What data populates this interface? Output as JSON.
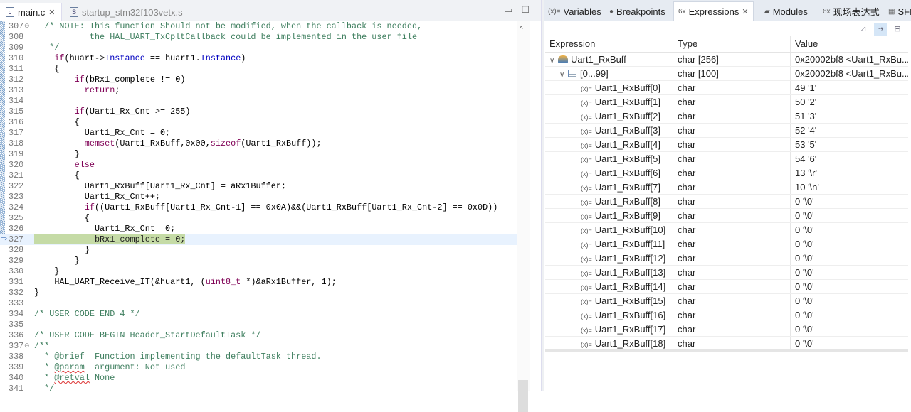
{
  "editor": {
    "tabs": [
      {
        "label": "main.c",
        "icon": "c-file-icon",
        "active": true
      },
      {
        "label": "startup_stm32f103vetx.s",
        "icon": "asm-file-icon",
        "active": false
      }
    ],
    "current_line": 327,
    "lines": [
      {
        "n": "307",
        "fold": true,
        "t": [
          [
            "cm",
            "  /* NOTE: This function Should not be modified, when the callback is needed,"
          ]
        ]
      },
      {
        "n": "308",
        "t": [
          [
            "cm",
            "           the HAL_UART_TxCpltCallback could be implemented in the user file"
          ]
        ]
      },
      {
        "n": "309",
        "t": [
          [
            "cm",
            "   */"
          ]
        ]
      },
      {
        "n": "310",
        "t": [
          [
            "pl",
            "    "
          ],
          [
            "kw",
            "if"
          ],
          [
            "pl",
            "(huart->"
          ],
          [
            "fld",
            "Instance"
          ],
          [
            "pl",
            " == huart1."
          ],
          [
            "fld",
            "Instance"
          ],
          [
            "pl",
            ")"
          ]
        ]
      },
      {
        "n": "311",
        "t": [
          [
            "pl",
            "    {"
          ]
        ]
      },
      {
        "n": "312",
        "t": [
          [
            "pl",
            "        "
          ],
          [
            "kw",
            "if"
          ],
          [
            "pl",
            "(bRx1_complete != 0)"
          ]
        ]
      },
      {
        "n": "313",
        "t": [
          [
            "pl",
            "          "
          ],
          [
            "kw",
            "return"
          ],
          [
            "pl",
            ";"
          ]
        ]
      },
      {
        "n": "314",
        "t": []
      },
      {
        "n": "315",
        "t": [
          [
            "pl",
            "        "
          ],
          [
            "kw",
            "if"
          ],
          [
            "pl",
            "(Uart1_Rx_Cnt >= 255)"
          ]
        ]
      },
      {
        "n": "316",
        "t": [
          [
            "pl",
            "        {"
          ]
        ]
      },
      {
        "n": "317",
        "t": [
          [
            "pl",
            "          Uart1_Rx_Cnt = 0;"
          ]
        ]
      },
      {
        "n": "318",
        "t": [
          [
            "pl",
            "          "
          ],
          [
            "kw",
            "memset"
          ],
          [
            "pl",
            "(Uart1_RxBuff,0x00,"
          ],
          [
            "kw",
            "sizeof"
          ],
          [
            "pl",
            "(Uart1_RxBuff));"
          ]
        ]
      },
      {
        "n": "319",
        "t": [
          [
            "pl",
            "        }"
          ]
        ]
      },
      {
        "n": "320",
        "t": [
          [
            "pl",
            "        "
          ],
          [
            "kw",
            "else"
          ]
        ]
      },
      {
        "n": "321",
        "t": [
          [
            "pl",
            "        {"
          ]
        ]
      },
      {
        "n": "322",
        "t": [
          [
            "pl",
            "          Uart1_RxBuff[Uart1_Rx_Cnt] = aRx1Buffer;"
          ]
        ]
      },
      {
        "n": "323",
        "t": [
          [
            "pl",
            "          Uart1_Rx_Cnt++;"
          ]
        ]
      },
      {
        "n": "324",
        "t": [
          [
            "pl",
            "          "
          ],
          [
            "kw",
            "if"
          ],
          [
            "pl",
            "((Uart1_RxBuff[Uart1_Rx_Cnt-1] == 0x0A)&&(Uart1_RxBuff[Uart1_Rx_Cnt-2] == 0x0D))"
          ]
        ]
      },
      {
        "n": "325",
        "t": [
          [
            "pl",
            "          {"
          ]
        ]
      },
      {
        "n": "326",
        "t": [
          [
            "pl",
            "            Uart1_Rx_Cnt= 0;"
          ]
        ]
      },
      {
        "n": "327",
        "t": [
          [
            "hl",
            "            bRx1_complete = 0;"
          ]
        ]
      },
      {
        "n": "328",
        "t": [
          [
            "pl",
            "          }"
          ]
        ]
      },
      {
        "n": "329",
        "t": [
          [
            "pl",
            "        }"
          ]
        ]
      },
      {
        "n": "330",
        "t": [
          [
            "pl",
            "    }"
          ]
        ]
      },
      {
        "n": "331",
        "t": [
          [
            "pl",
            "    HAL_UART_Receive_IT(&huart1, ("
          ],
          [
            "kw",
            "uint8_t"
          ],
          [
            "pl",
            " *)&aRx1Buffer, 1);"
          ]
        ]
      },
      {
        "n": "332",
        "t": [
          [
            "pl",
            "}"
          ]
        ]
      },
      {
        "n": "333",
        "t": []
      },
      {
        "n": "334",
        "t": [
          [
            "cm",
            "/* USER CODE END 4 */"
          ]
        ]
      },
      {
        "n": "335",
        "t": []
      },
      {
        "n": "336",
        "t": [
          [
            "cm",
            "/* USER CODE BEGIN Header_StartDefaultTask */"
          ]
        ]
      },
      {
        "n": "337",
        "fold": true,
        "t": [
          [
            "cm",
            "/**"
          ]
        ]
      },
      {
        "n": "338",
        "t": [
          [
            "cm",
            "  * @brief  Function implementing the defaultTask thread."
          ]
        ]
      },
      {
        "n": "339",
        "t": [
          [
            "cm",
            "  * "
          ],
          [
            "ann",
            "@param"
          ],
          [
            "cm",
            "  argument: Not used"
          ]
        ]
      },
      {
        "n": "340",
        "t": [
          [
            "cm",
            "  * "
          ],
          [
            "ann",
            "@retval"
          ],
          [
            "cm",
            " None"
          ]
        ]
      },
      {
        "n": "341",
        "t": [
          [
            "cm",
            "  */"
          ]
        ]
      }
    ]
  },
  "panel": {
    "tabs": [
      {
        "label": "Variables",
        "icon": "(x)="
      },
      {
        "label": "Breakpoints",
        "icon": "●"
      },
      {
        "label": "Expressions",
        "icon": "6x",
        "active": true
      },
      {
        "label": "Modules",
        "icon": "▰"
      },
      {
        "label": "现场表达式",
        "icon": "6x"
      },
      {
        "label": "SFRs",
        "icon": "▦"
      }
    ],
    "columns": [
      "Expression",
      "Type",
      "Value"
    ],
    "root": {
      "expression": "Uart1_RxBuff",
      "type": "char [256]",
      "value": "0x20002bf8 <Uart1_RxBu..."
    },
    "range": {
      "expression": "[0...99]",
      "type": "char [100]",
      "value": "0x20002bf8 <Uart1_RxBu..."
    },
    "rows": [
      {
        "expression": "Uart1_RxBuff[0]",
        "type": "char",
        "value": "49 '1'"
      },
      {
        "expression": "Uart1_RxBuff[1]",
        "type": "char",
        "value": "50 '2'"
      },
      {
        "expression": "Uart1_RxBuff[2]",
        "type": "char",
        "value": "51 '3'"
      },
      {
        "expression": "Uart1_RxBuff[3]",
        "type": "char",
        "value": "52 '4'"
      },
      {
        "expression": "Uart1_RxBuff[4]",
        "type": "char",
        "value": "53 '5'"
      },
      {
        "expression": "Uart1_RxBuff[5]",
        "type": "char",
        "value": "54 '6'"
      },
      {
        "expression": "Uart1_RxBuff[6]",
        "type": "char",
        "value": "13 '\\r'"
      },
      {
        "expression": "Uart1_RxBuff[7]",
        "type": "char",
        "value": "10 '\\n'"
      },
      {
        "expression": "Uart1_RxBuff[8]",
        "type": "char",
        "value": "0 '\\0'"
      },
      {
        "expression": "Uart1_RxBuff[9]",
        "type": "char",
        "value": "0 '\\0'"
      },
      {
        "expression": "Uart1_RxBuff[10]",
        "type": "char",
        "value": "0 '\\0'"
      },
      {
        "expression": "Uart1_RxBuff[11]",
        "type": "char",
        "value": "0 '\\0'"
      },
      {
        "expression": "Uart1_RxBuff[12]",
        "type": "char",
        "value": "0 '\\0'"
      },
      {
        "expression": "Uart1_RxBuff[13]",
        "type": "char",
        "value": "0 '\\0'"
      },
      {
        "expression": "Uart1_RxBuff[14]",
        "type": "char",
        "value": "0 '\\0'"
      },
      {
        "expression": "Uart1_RxBuff[15]",
        "type": "char",
        "value": "0 '\\0'"
      },
      {
        "expression": "Uart1_RxBuff[16]",
        "type": "char",
        "value": "0 '\\0'"
      },
      {
        "expression": "Uart1_RxBuff[17]",
        "type": "char",
        "value": "0 '\\0'"
      },
      {
        "expression": "Uart1_RxBuff[18]",
        "type": "char",
        "value": "0 '\\0'"
      }
    ]
  }
}
